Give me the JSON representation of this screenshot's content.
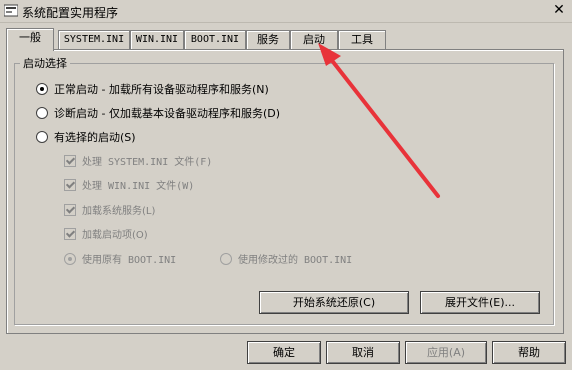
{
  "window": {
    "title": "系统配置实用程序",
    "close_glyph": "✕"
  },
  "tabs": [
    {
      "label": "一般",
      "active": true
    },
    {
      "label": "SYSTEM.INI"
    },
    {
      "label": "WIN.INI"
    },
    {
      "label": "BOOT.INI"
    },
    {
      "label": "服务"
    },
    {
      "label": "启动"
    },
    {
      "label": "工具"
    }
  ],
  "startup_selection": {
    "legend": "启动选择",
    "options": [
      {
        "label": "正常启动 - 加载所有设备驱动程序和服务(N)",
        "selected": true
      },
      {
        "label": "诊断启动 - 仅加载基本设备驱动程序和服务(D)",
        "selected": false
      },
      {
        "label": "有选择的启动(S)",
        "selected": false
      }
    ],
    "selective_items": [
      {
        "label": "处理 SYSTEM.INI 文件(F)",
        "checked": true
      },
      {
        "label": "处理 WIN.INI 文件(W)",
        "checked": true
      },
      {
        "label": "加载系统服务(L)",
        "checked": true
      },
      {
        "label": "加载启动项(O)",
        "checked": true
      }
    ],
    "boot_ini": {
      "use_original": "使用原有 BOOT.INI",
      "use_modified": "使用修改过的 BOOT.INI"
    },
    "restore_button": "开始系统还原(C)",
    "expand_button": "展开文件(E)..."
  },
  "footer": {
    "ok": "确定",
    "cancel": "取消",
    "apply": "应用(A)",
    "help": "帮助"
  },
  "annotation": {
    "arrow_color": "#e8333a"
  }
}
